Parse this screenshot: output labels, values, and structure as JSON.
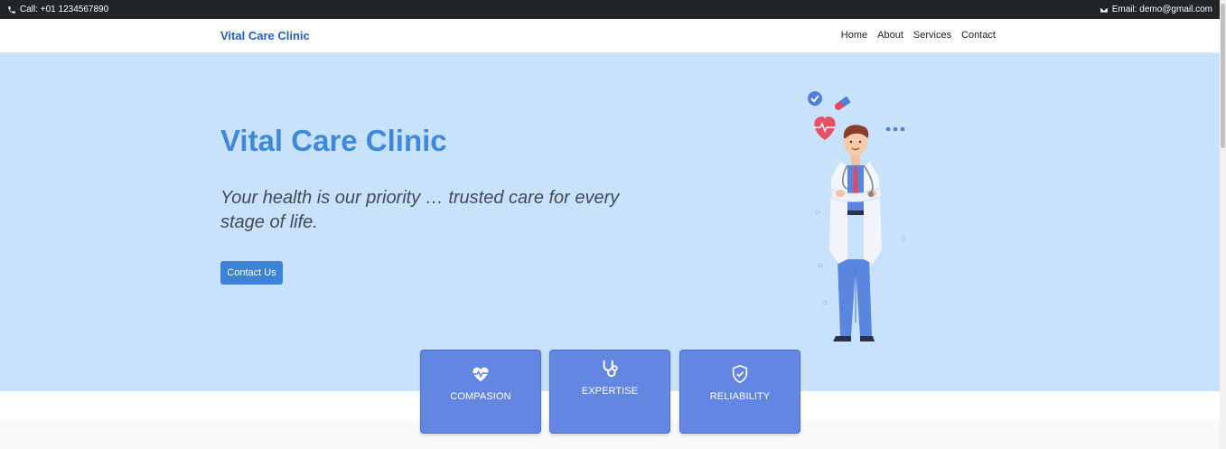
{
  "topbar": {
    "phone": "Call: +01 1234567890",
    "email": "Email: demo@gmail.com"
  },
  "nav": {
    "brand": "Vital Care Clinic",
    "links": [
      "Home",
      "About",
      "Services",
      "Contact"
    ]
  },
  "hero": {
    "title": "Vital Care Clinic",
    "subtitle": "Your health is our priority … trusted care for every stage of life.",
    "cta": "Contact Us"
  },
  "cards": [
    {
      "label": "COMPASION",
      "icon": "heart-pulse-icon"
    },
    {
      "label": "EXPERTISE",
      "icon": "stethoscope-icon"
    },
    {
      "label": "RELIABILITY",
      "icon": "shield-check-icon"
    }
  ],
  "colors": {
    "hero_bg": "#c9e2fb",
    "accent": "#3a83d5",
    "card_bg": "#6486e3",
    "brand": "#1f5fc8"
  }
}
